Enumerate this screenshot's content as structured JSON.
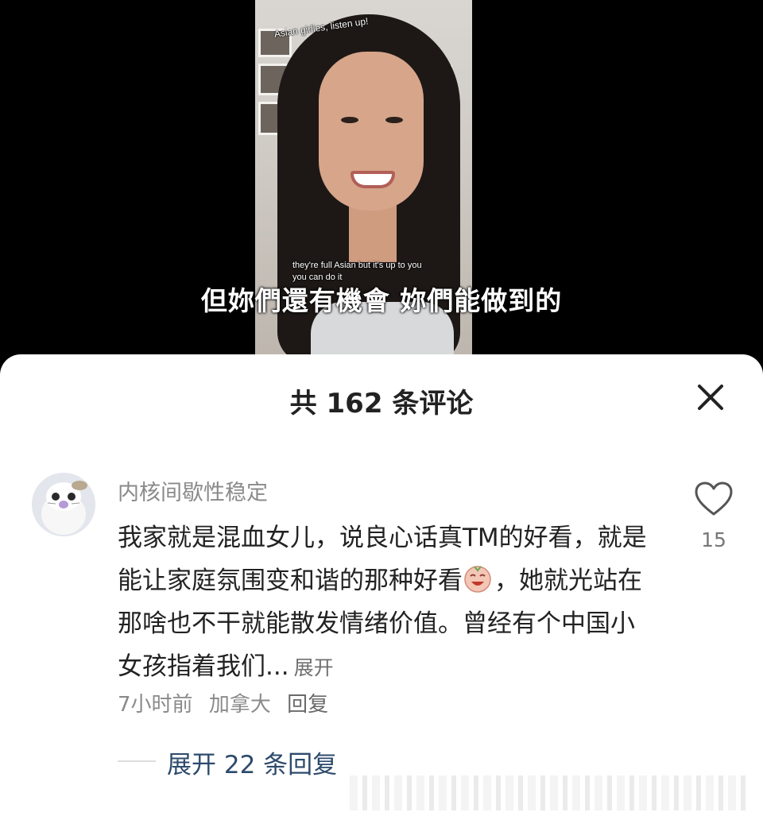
{
  "video": {
    "caption_top": "Asian girlies, listen up!",
    "caption_en": "they're full Asian but it's up to you you can do it",
    "caption_zh": "但妳們還有機會 妳們能做到的"
  },
  "comments_panel": {
    "title": "共 162 条评论",
    "close_icon": "close-icon"
  },
  "comment": {
    "username": "内核间歇性稳定",
    "body_part1": "我家就是混血女儿，说良心话真TM的好看，就是能让家庭氛围变和谐的那种好看",
    "emoji": "laughing-crying-emoji",
    "body_part2": "，她就光站在那啥也不干就能散发情绪价值。曾经有个中国小女孩指着我们...",
    "expand_label": "展开",
    "time": "7小时前",
    "location": "加拿大",
    "reply_label": "回复",
    "like_icon": "heart-outline-icon",
    "like_count": "15"
  },
  "replies": {
    "expand_label": "展开 22 条回复"
  }
}
